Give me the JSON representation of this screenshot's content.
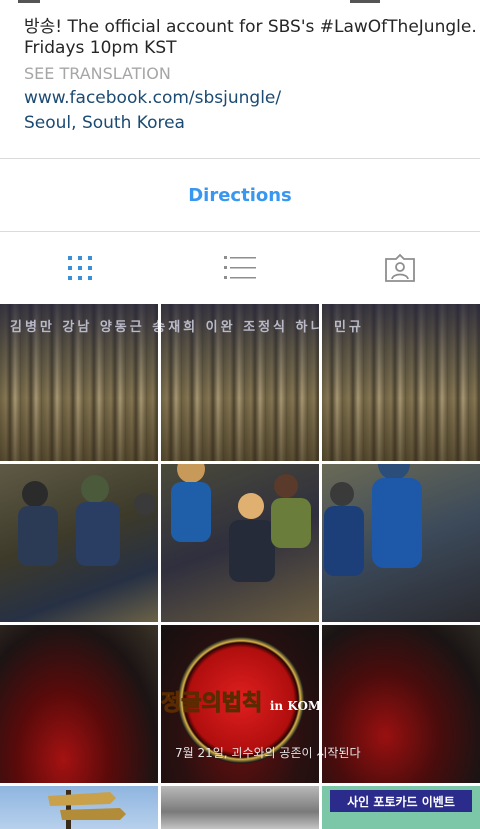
{
  "profile": {
    "bio_line1": "방송! The official account for SBS's #LawOfTheJungle.",
    "bio_line2": "Fridays 10pm KST",
    "see_translation": "SEE TRANSLATION",
    "website": "www.facebook.com/sbsjungle/",
    "location": "Seoul, South Korea"
  },
  "actions": {
    "directions_label": "Directions"
  },
  "view_tabs": [
    {
      "name": "grid-view",
      "icon": "grid-icon",
      "active": true
    },
    {
      "name": "list-view",
      "icon": "list-icon",
      "active": false
    },
    {
      "name": "tagged-view",
      "icon": "tagged-person-icon",
      "active": false
    }
  ],
  "posts": {
    "poster_cast_names": "김병만 강남 양동근 송재희 이완 조정식 하니 민규",
    "poster_logo_title": "정글의법칙",
    "poster_logo_subtitle": "in KOMODO",
    "poster_caption": "7월 21일, 괴수와의 공존이 시작된다",
    "event_banner": "사인 포토카드 이벤트"
  },
  "colors": {
    "link_blue": "#3897f0",
    "url_blue": "#1b4a72",
    "tab_icon": "#3b8fd8",
    "divider": "#dbdbdb"
  }
}
